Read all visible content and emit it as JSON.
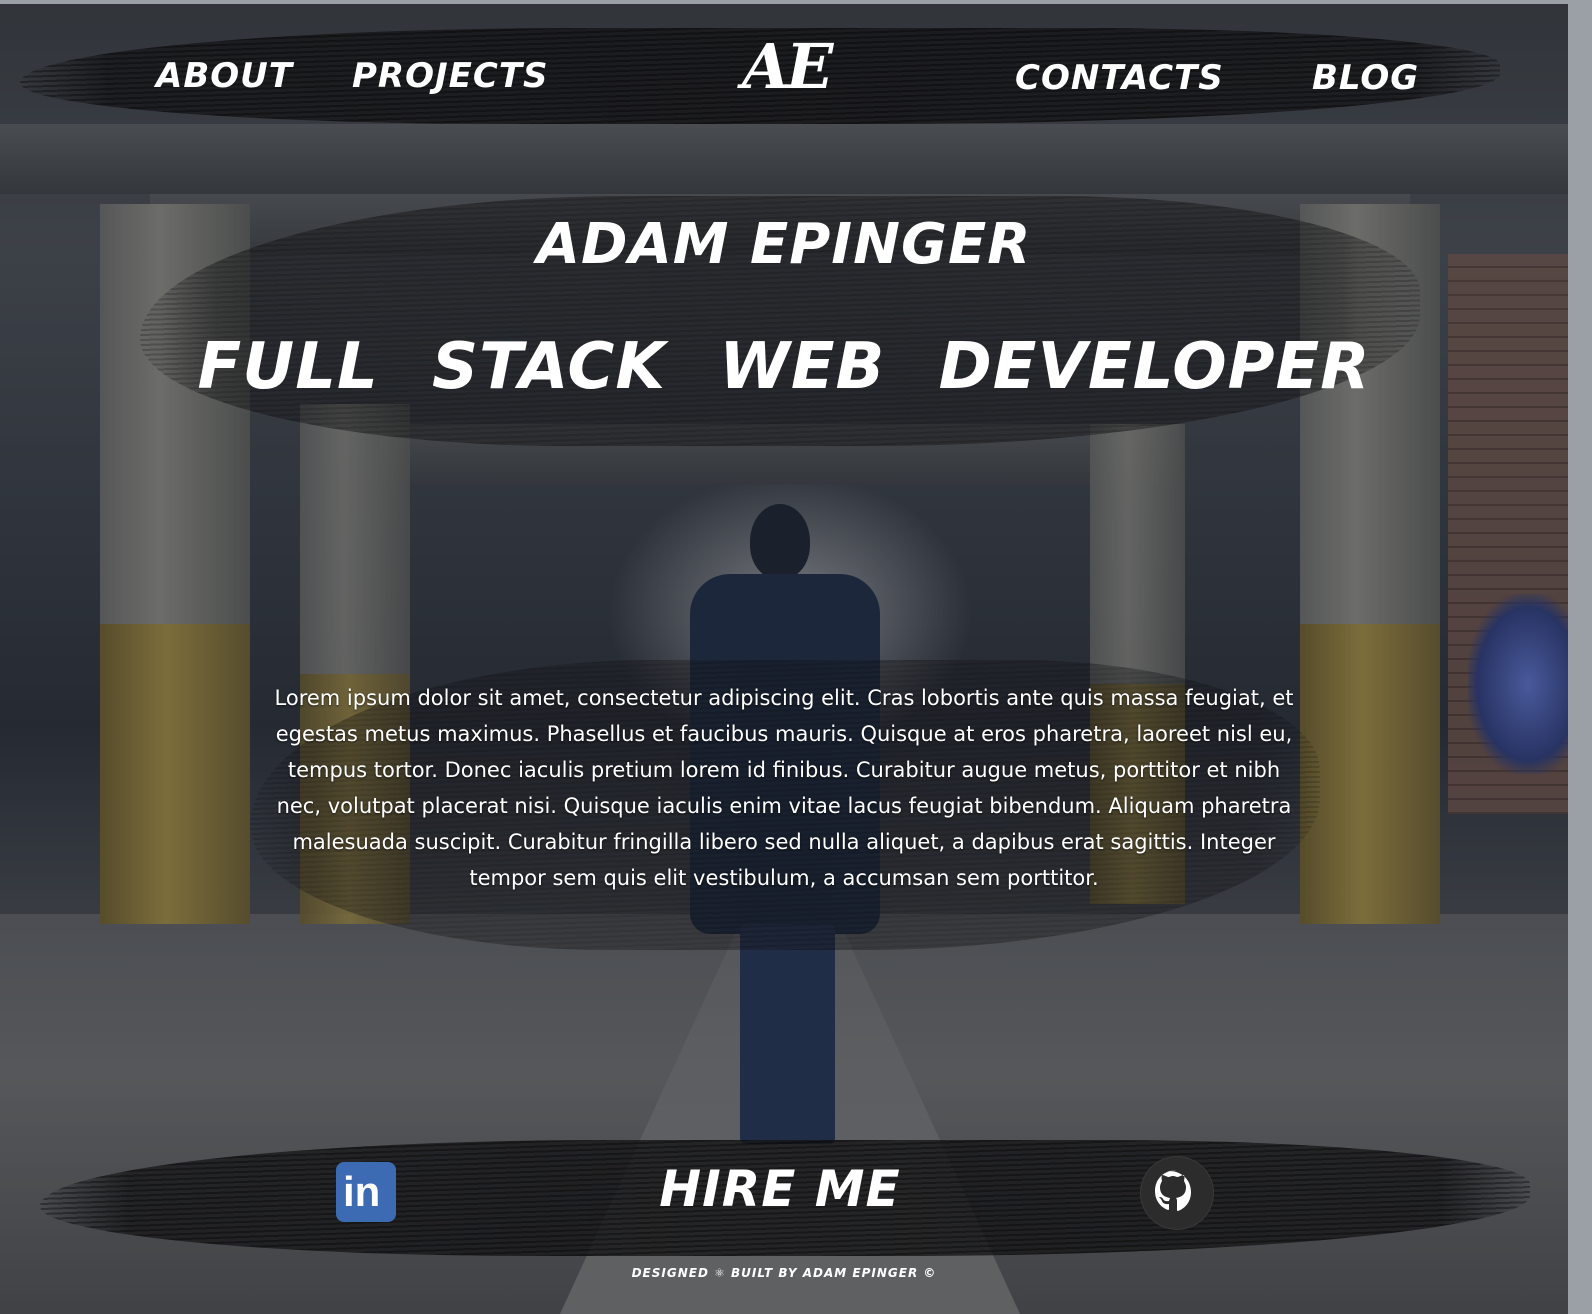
{
  "logo": {
    "text": "AE"
  },
  "nav": {
    "items": [
      {
        "label": "About"
      },
      {
        "label": "Projects"
      },
      {
        "label": "Contacts"
      },
      {
        "label": "Blog"
      }
    ]
  },
  "hero": {
    "name": "Adam Epinger",
    "role": "Full Stack Web Developer"
  },
  "bio": {
    "text": "Lorem ipsum dolor sit amet, consectetur adipiscing elit. Cras lobortis ante quis massa feugiat, et egestas metus maximus. Phasellus et faucibus mauris. Quisque at eros pharetra, laoreet nisl eu, tempus tortor. Donec iaculis pretium lorem id finibus. Curabitur augue metus, porttitor et nibh nec, volutpat placerat nisi. Quisque iaculis enim vitae lacus feugiat bibendum. Aliquam pharetra malesuada suscipit. Curabitur fringilla libero sed nulla aliquet, a dapibus erat sagittis. Integer tempor sem quis elit vestibulum, a accumsan sem porttitor."
  },
  "cta": {
    "linkedin_icon": "linkedin-icon",
    "linkedin_text": "in",
    "hire_label": "Hire me",
    "github_icon": "github-icon"
  },
  "footer": {
    "text": "Designed ⚛ built by Adam Epinger ©"
  },
  "colors": {
    "linkedin": "#3d6bb3",
    "text": "#ffffff"
  }
}
